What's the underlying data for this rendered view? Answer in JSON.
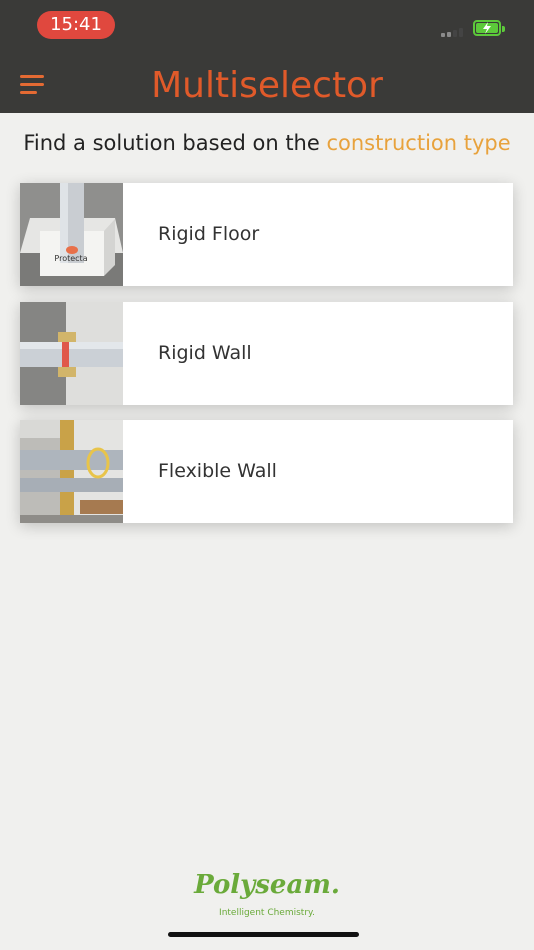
{
  "status_bar": {
    "time": "15:41"
  },
  "header": {
    "title": "Multiselector",
    "menu_icon": "hamburger-menu-icon"
  },
  "subtitle": {
    "prefix": "Find a solution based on the ",
    "highlight": "construction type"
  },
  "items": [
    {
      "label": "Rigid Floor",
      "thumb": "rigid-floor-image",
      "thumb_text": "Protecta"
    },
    {
      "label": "Rigid Wall",
      "thumb": "rigid-wall-image"
    },
    {
      "label": "Flexible Wall",
      "thumb": "flexible-wall-image"
    }
  ],
  "footer": {
    "brand": "Polyseam.",
    "tagline": "Intelligent Chemistry."
  },
  "colors": {
    "header_bg": "#3a3a38",
    "accent": "#e05a2a",
    "highlight": "#e8a23c",
    "brand_green": "#6aaa3a"
  }
}
